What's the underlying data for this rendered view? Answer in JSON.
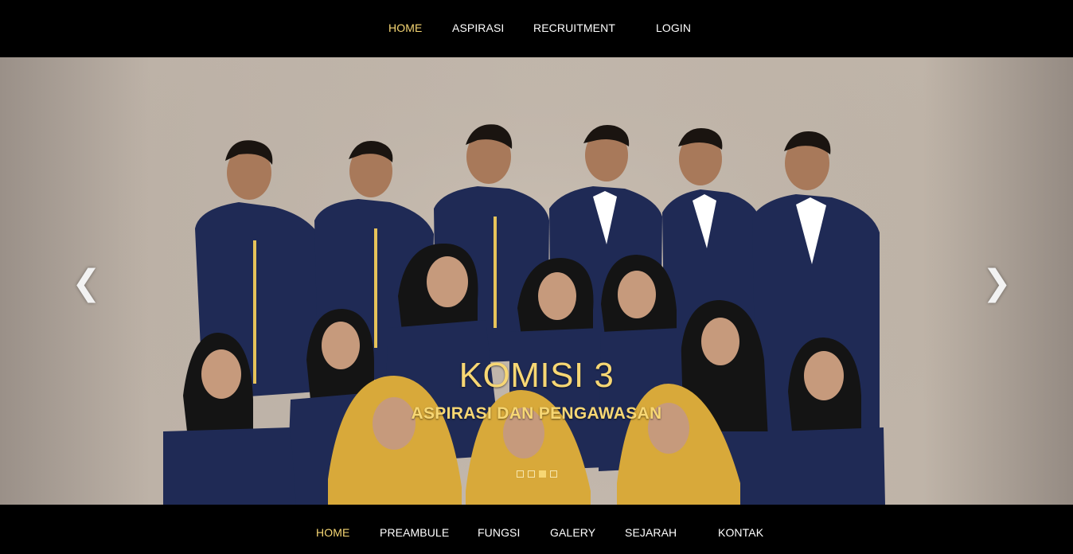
{
  "top_nav": {
    "items": [
      {
        "label": "HOME",
        "active": true
      },
      {
        "label": "ASPIRASI",
        "active": false
      },
      {
        "label": "RECRUITMENT",
        "active": false
      },
      {
        "label": "LOGIN",
        "active": false
      }
    ]
  },
  "slider": {
    "title": "KOMISI 3",
    "subtitle": "ASPIRASI DAN PENGAWASAN",
    "prev_icon": "❮",
    "next_icon": "❯",
    "slide_count": 4,
    "active_slide_index": 2
  },
  "bottom_nav": {
    "items": [
      {
        "label": "HOME",
        "active": true
      },
      {
        "label": "PREAMBULE",
        "active": false
      },
      {
        "label": "FUNGSI",
        "active": false
      },
      {
        "label": "GALERY",
        "active": false
      },
      {
        "label": "SEJARAH",
        "active": false
      },
      {
        "label": "KONTAK",
        "active": false
      }
    ]
  },
  "colors": {
    "accent": "#f7d774",
    "nav_background": "#000000",
    "nav_text": "#ffffff",
    "uniform_navy": "#1f2a55",
    "hijab_yellow": "#d8a93a"
  }
}
